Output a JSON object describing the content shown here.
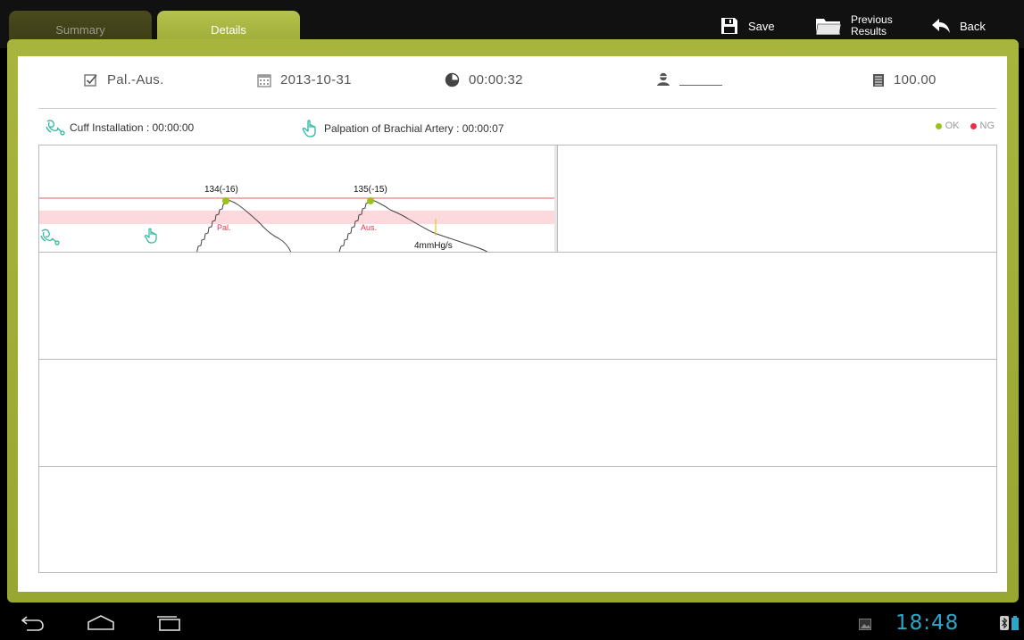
{
  "tabs": {
    "summary": "Summary",
    "details": "Details"
  },
  "toolbar": {
    "save": "Save",
    "previous_line1": "Previous",
    "previous_line2": "Results",
    "back": "Back"
  },
  "info": {
    "mode": "Pal.-Aus.",
    "mode_checked": true,
    "date": "2013-10-31",
    "elapsed": "00:00:32",
    "user": "",
    "score": "100.00"
  },
  "status": {
    "cuff": "Cuff Installation : 00:00:00",
    "palpation": "Palpation of Brachial Artery : 00:00:07"
  },
  "legend": {
    "ok": "OK",
    "ng": "NG",
    "ok_color": "#9ac21a",
    "ng_color": "#e8304a"
  },
  "chart_data": {
    "type": "line",
    "annotations": [
      {
        "label": "134(-16)",
        "marker": "Pal."
      },
      {
        "label": "135(-15)",
        "marker": "Aus."
      }
    ],
    "rate_label": "4mmHg/s",
    "reference_color": "#e06060",
    "band_color": "#fbd9dd",
    "accent_color": "#2ab7a0"
  },
  "system": {
    "clock": "18:48"
  },
  "colors": {
    "frame": "#a3b03a",
    "tab_active": "#aab844",
    "clock": "#2aa7c9"
  }
}
